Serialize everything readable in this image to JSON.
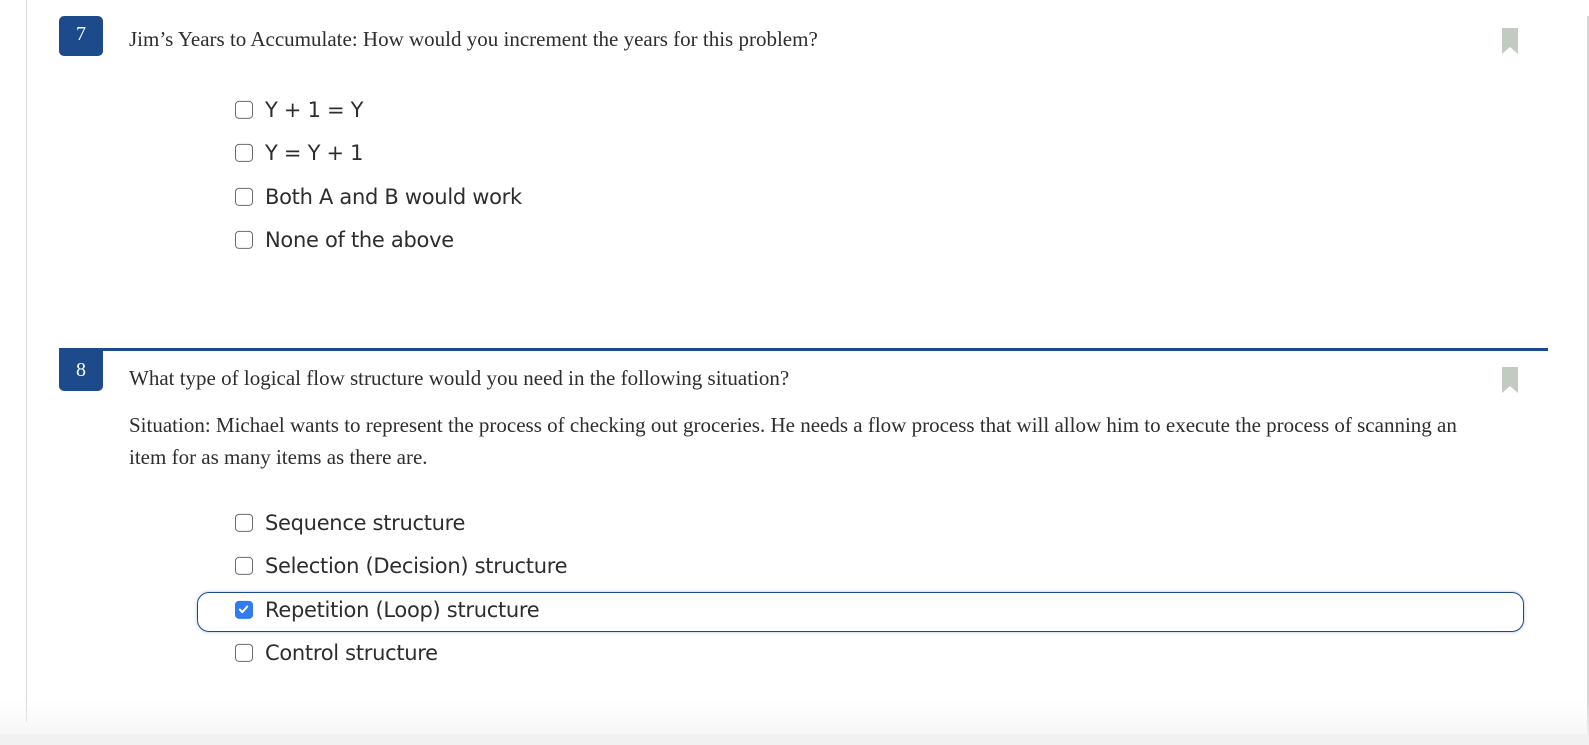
{
  "colors": {
    "accent": "#1c4a8a",
    "checkbox_checked": "#2f7bf0",
    "bookmark": "#c3cac2",
    "text": "#2d2d2d"
  },
  "questions": [
    {
      "number": "7",
      "title": "Jim’s Years to Accumulate: How would you increment the years for this problem?",
      "body": "",
      "bookmark_icon": "bookmark-icon",
      "options": [
        {
          "label": "Y + 1 = Y",
          "checked": false
        },
        {
          "label": "Y = Y + 1",
          "checked": false
        },
        {
          "label": "Both A and B would work",
          "checked": false
        },
        {
          "label": "None of the above",
          "checked": false
        }
      ]
    },
    {
      "number": "8",
      "title": "What type of logical flow structure would you need in the following situation?",
      "body": "Situation: Michael wants to represent the process of checking out groceries. He needs a flow process that will allow him to execute the process of scanning an item for as many items as there are.",
      "bookmark_icon": "bookmark-icon",
      "options": [
        {
          "label": "Sequence structure",
          "checked": false
        },
        {
          "label": "Selection (Decision) structure",
          "checked": false
        },
        {
          "label": "Repetition (Loop) structure",
          "checked": true
        },
        {
          "label": "Control structure",
          "checked": false
        }
      ]
    }
  ]
}
